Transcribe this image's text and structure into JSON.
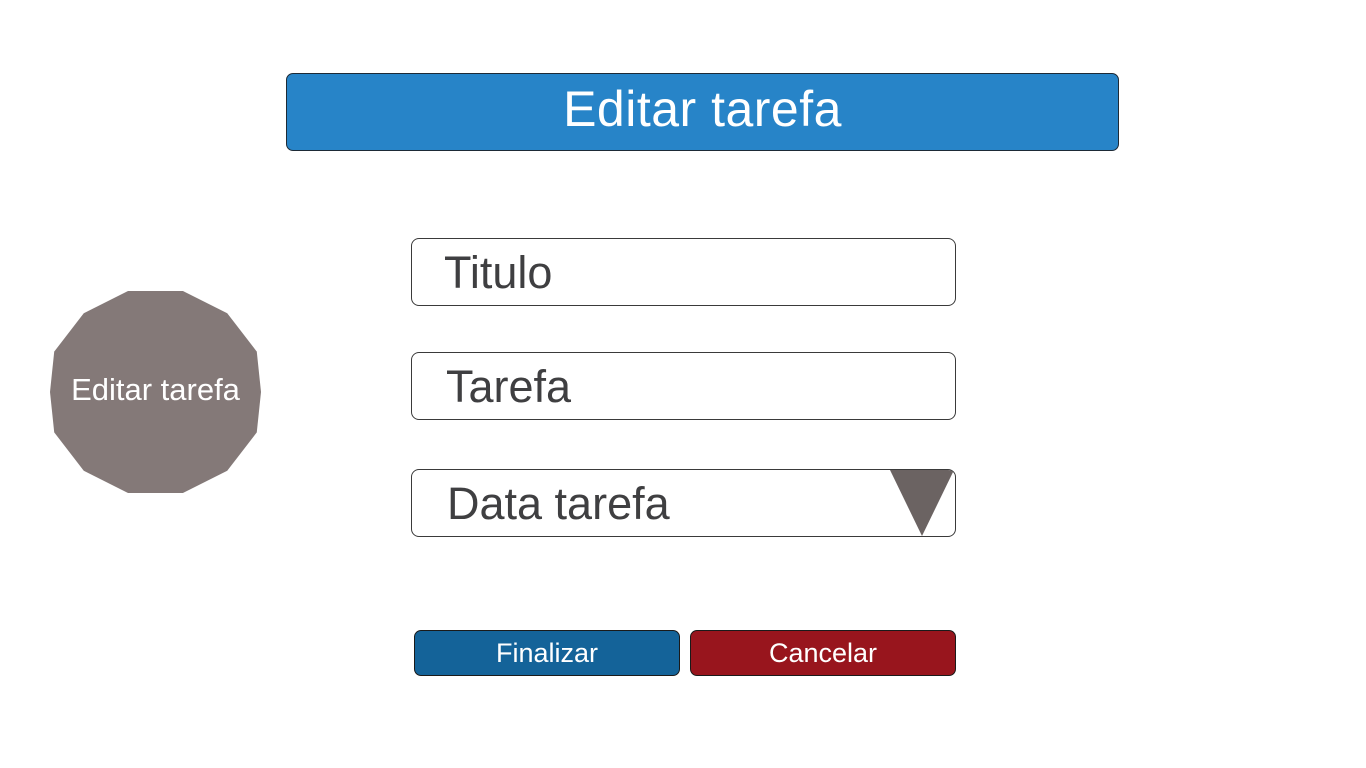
{
  "header": {
    "title": "Editar tarefa",
    "color": "#2784c8"
  },
  "side_badge": {
    "label": "Editar tarefa",
    "color": "#847978"
  },
  "form": {
    "fields": [
      {
        "label": "Titulo"
      },
      {
        "label": "Tarefa"
      },
      {
        "label": "Data tarefa",
        "icon": "chevron-down-icon"
      }
    ]
  },
  "actions": {
    "finalizar_label": "Finalizar",
    "finalizar_color": "#146399",
    "cancelar_label": "Cancelar",
    "cancelar_color": "#98151d"
  }
}
